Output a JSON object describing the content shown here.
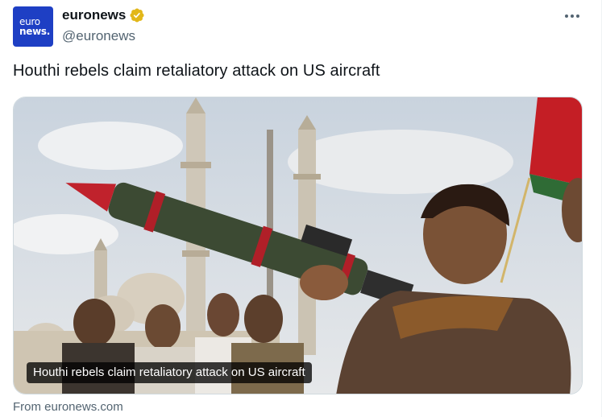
{
  "tweet": {
    "author": {
      "display_name": "euronews",
      "handle": "@euronews",
      "verified": true,
      "avatar": {
        "line1": "euro",
        "line2": "news.",
        "color": "#1e3fc4"
      }
    },
    "more_icon": "more-horizontal-icon",
    "text": "Houthi rebels claim retaliatory attack on US aircraft",
    "card": {
      "headline": "Houthi rebels claim retaliatory attack on US aircraft",
      "source": "From euronews.com"
    }
  },
  "colors": {
    "text_primary": "#0f1419",
    "text_secondary": "#536471",
    "verified_gold": "#e2b719"
  }
}
